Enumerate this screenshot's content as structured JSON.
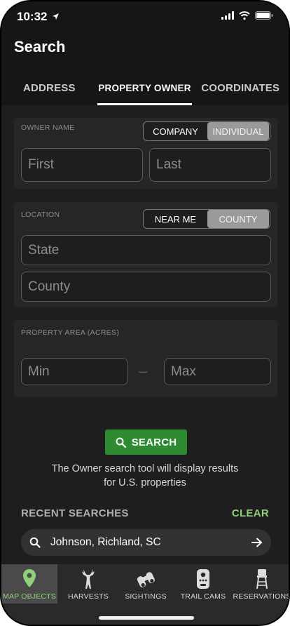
{
  "status": {
    "time": "10:32"
  },
  "header": {
    "title": "Search",
    "tabs": [
      "ADDRESS",
      "PROPERTY OWNER",
      "COORDINATES"
    ]
  },
  "owner": {
    "label": "OWNER NAME",
    "toggle": [
      "COMPANY",
      "INDIVIDUAL"
    ],
    "selected": "INDIVIDUAL",
    "first_placeholder": "First",
    "last_placeholder": "Last"
  },
  "location": {
    "label": "LOCATION",
    "toggle": [
      "NEAR ME",
      "COUNTY"
    ],
    "selected": "COUNTY",
    "state_placeholder": "State",
    "county_placeholder": "County"
  },
  "area": {
    "label": "PROPERTY AREA (ACRES)",
    "min_placeholder": "Min",
    "separator": "–",
    "max_placeholder": "Max"
  },
  "search_button": "SEARCH",
  "info_line1": "The Owner search tool will display results",
  "info_line2": "for U.S. properties",
  "recent": {
    "title": "RECENT SEARCHES",
    "clear": "CLEAR",
    "items": [
      "Johnson, Richland, SC"
    ]
  },
  "nav": [
    {
      "label": "MAP OBJECTS",
      "icon": "map-pin-icon",
      "active": true
    },
    {
      "label": "HARVESTS",
      "icon": "deer-icon",
      "active": false
    },
    {
      "label": "SIGHTINGS",
      "icon": "binoculars-icon",
      "active": false
    },
    {
      "label": "TRAIL CAMS",
      "icon": "trail-camera-icon",
      "active": false
    },
    {
      "label": "RESERVATIONS",
      "icon": "tree-stand-icon",
      "active": false
    }
  ],
  "colors": {
    "accent_green": "#2e8b32",
    "clear_green": "#8fd07a",
    "background": "#1e1e1e"
  }
}
